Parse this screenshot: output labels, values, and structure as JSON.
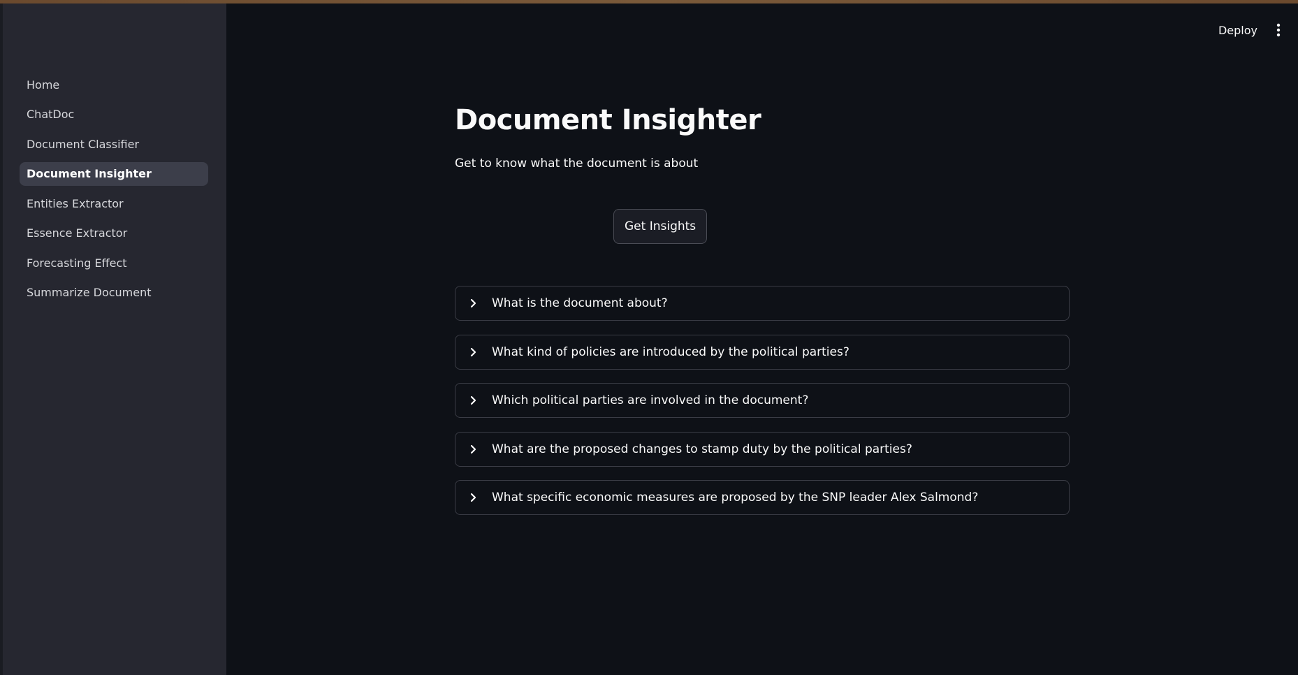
{
  "sidebar": {
    "items": [
      {
        "label": "Home",
        "active": false
      },
      {
        "label": "ChatDoc",
        "active": false
      },
      {
        "label": "Document Classifier",
        "active": false
      },
      {
        "label": "Document Insighter",
        "active": true
      },
      {
        "label": "Entities Extractor",
        "active": false
      },
      {
        "label": "Essence Extractor",
        "active": false
      },
      {
        "label": "Forecasting Effect",
        "active": false
      },
      {
        "label": "Summarize Document",
        "active": false
      }
    ]
  },
  "header": {
    "deploy_label": "Deploy",
    "menu_icon": "kebab-menu-icon"
  },
  "main": {
    "title": "Document Insighter",
    "subtitle": "Get to know what the document is about",
    "button_label": "Get Insights",
    "expanders": [
      {
        "label": "What is the document about?"
      },
      {
        "label": "What kind of policies are introduced by the political parties?"
      },
      {
        "label": "Which political parties are involved in the document?"
      },
      {
        "label": "What are the proposed changes to stamp duty by the political parties?"
      },
      {
        "label": "What specific economic measures are proposed by the SNP leader Alex Salmond?"
      }
    ]
  },
  "colors": {
    "background": "#0e1117",
    "sidebar": "#262730",
    "active_item": "#3c3e4a",
    "text": "#fafafa",
    "top_accent": "#7a5a3a"
  }
}
